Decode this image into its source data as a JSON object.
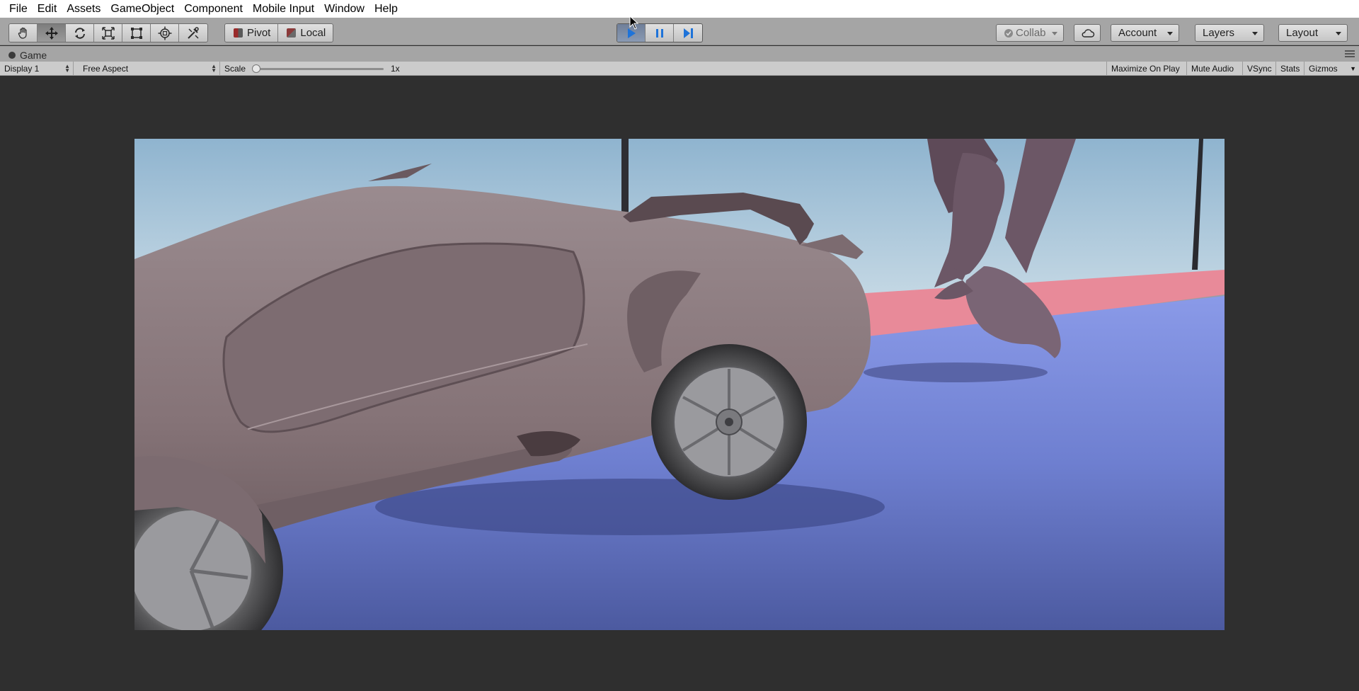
{
  "menu": [
    "File",
    "Edit",
    "Assets",
    "GameObject",
    "Component",
    "Mobile Input",
    "Window",
    "Help"
  ],
  "toolbar": {
    "transform_tools": [
      "hand-tool",
      "move-tool",
      "rotate-tool",
      "scale-tool",
      "rect-tool",
      "transform-tool",
      "custom-tool"
    ],
    "active_tool": "move-tool",
    "pivot_label": "Pivot",
    "local_label": "Local",
    "play_state": "playing",
    "collab_label": "Collab",
    "account_label": "Account",
    "layers_label": "Layers",
    "layout_label": "Layout"
  },
  "tab": {
    "title": "Game"
  },
  "game_bar": {
    "display": "Display 1",
    "aspect": "Free Aspect",
    "scale_label": "Scale",
    "scale_value": "1x",
    "maximize_on_play": "Maximize On Play",
    "mute_audio": "Mute Audio",
    "vsync": "VSync",
    "stats": "Stats",
    "gizmos": "Gizmos"
  },
  "colors": {
    "sky_top": "#8fb4cf",
    "sky_bottom": "#e6ecef",
    "floor_blue": "#6e7fd0",
    "floor_red": "#e88a99",
    "car_body": "#857377",
    "play_blue": "#1e73d9"
  }
}
